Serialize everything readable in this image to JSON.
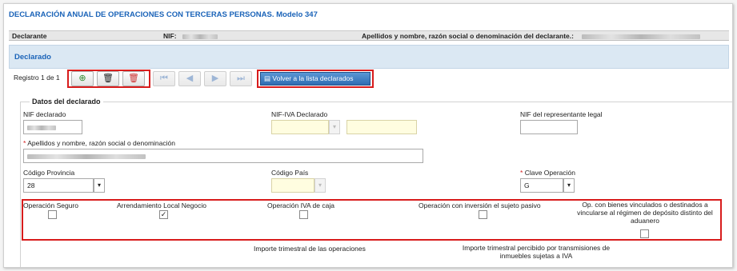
{
  "header": {
    "title": "DECLARACIÓN ANUAL DE OPERACIONES CON TERCERAS PERSONAS. Modelo 347",
    "declarante_label": "Declarante",
    "nif_label": "NIF:",
    "apellidos_label": "Apellidos y nombre, razón social o denominación del declarante.:"
  },
  "panel": {
    "title": "Declarado"
  },
  "toolbar": {
    "registro": "Registro 1 de 1",
    "volver_label": "Volver a la lista declarados",
    "icons": [
      "add-icon",
      "delete-icon",
      "delete-all-icon",
      "first-icon",
      "prev-icon",
      "next-icon",
      "last-icon",
      "list-icon"
    ]
  },
  "form": {
    "section_title": "Datos del declarado",
    "nif_declarado_label": "NIF declarado",
    "nif_iva_label": "NIF-IVA Declarado",
    "nif_representante_label": "NIF del representante legal",
    "apellidos_label": "Apellidos y nombre, razón social o denominación",
    "codigo_provincia_label": "Código Provincia",
    "codigo_provincia_value": "28",
    "codigo_pais_label": "Código País",
    "clave_operacion_label": "Clave Operación",
    "clave_operacion_value": "G"
  },
  "operations": [
    {
      "label": "Operación Seguro",
      "checked": false
    },
    {
      "label": "Arrendamiento Local Negocio",
      "checked": true
    },
    {
      "label": "Operación IVA de caja",
      "checked": false
    },
    {
      "label": "Operación con inversión el sujeto pasivo",
      "checked": false
    },
    {
      "label": "Op. con bienes vinculados o destinados a vincularse al régimen de depósito distinto del aduanero",
      "checked": false
    }
  ],
  "importes": {
    "trimestral_label": "Importe trimestral de las operaciones",
    "transmisiones_label": "Importe trimestral percibido por transmisiones de inmuebles sujetas a IVA"
  },
  "colors": {
    "accent": "#1a63b8",
    "highlight_box": "#d81c1c",
    "panel_bg": "#dbe8f3",
    "button": "#2f6db3"
  }
}
